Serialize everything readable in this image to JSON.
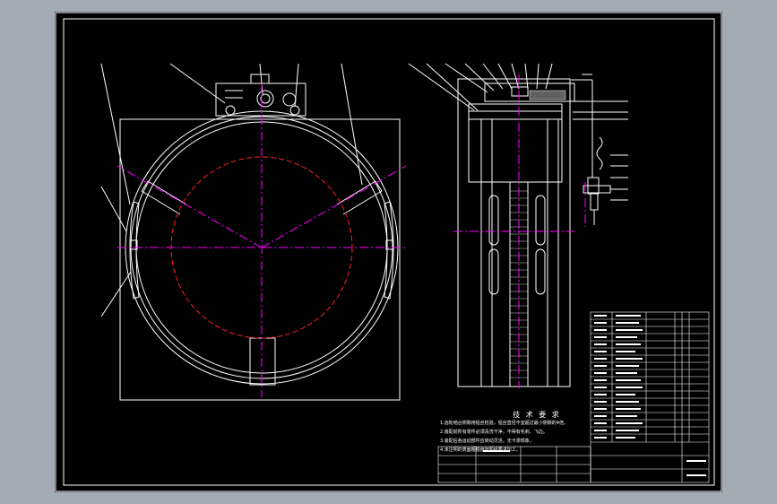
{
  "drawing": {
    "background": "#000000",
    "frame_color": "#ffffff",
    "centerline_color": "#ff00ff",
    "pitch_circle_color": "#ff2020"
  },
  "technical_requirements": {
    "title": "技 术 要 求",
    "lines": [
      "1.齿轮啮合侧隙用铅丝检验，铅丝直径不宜超过最小侧隙的4倍。",
      "2.装配前所有零件必须清洗干净，不得有毛刺、飞边。",
      "3.装配后各运动部件应转动灵活，无卡滞现象。",
      "4.未注明的表面粗糙度按图纸要求加工。"
    ]
  }
}
